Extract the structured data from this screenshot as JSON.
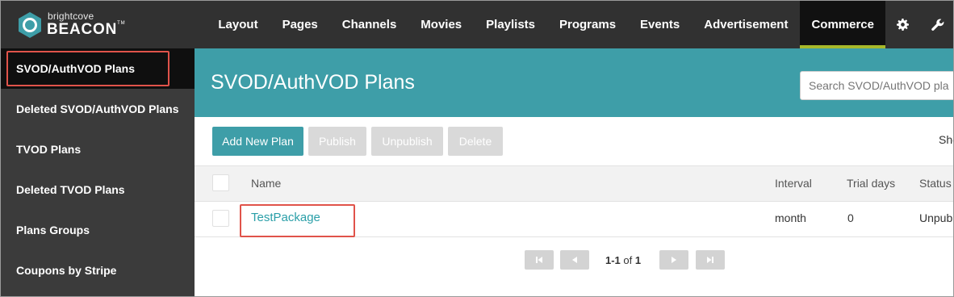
{
  "brand": {
    "small": "brightcove",
    "big": "BEACON",
    "tm": "TM"
  },
  "nav": {
    "items": [
      "Layout",
      "Pages",
      "Channels",
      "Movies",
      "Playlists",
      "Programs",
      "Events",
      "Advertisement",
      "Commerce"
    ],
    "active": "Commerce",
    "icons": [
      "gear-icon",
      "wrench-icon"
    ]
  },
  "sidebar": {
    "items": [
      {
        "label": "SVOD/AuthVOD Plans"
      },
      {
        "label": "Deleted SVOD/AuthVOD Plans"
      },
      {
        "label": "TVOD Plans"
      },
      {
        "label": "Deleted TVOD Plans"
      },
      {
        "label": "Plans Groups"
      },
      {
        "label": "Coupons by Stripe"
      }
    ]
  },
  "main": {
    "title": "SVOD/AuthVOD Plans",
    "search_placeholder": "Search SVOD/AuthVOD pla",
    "buttons": {
      "add": "Add New Plan",
      "publish": "Publish",
      "unpublish": "Unpublish",
      "delete": "Delete"
    },
    "show_label": "Sho",
    "table": {
      "columns": [
        "Name",
        "Interval",
        "Trial days",
        "Status"
      ],
      "rows": [
        {
          "name": "TestPackage",
          "interval": "month",
          "trial_days": "0",
          "status": "Unpub"
        }
      ]
    },
    "pagination": {
      "range": "1-1",
      "of": "of",
      "total": "1"
    }
  },
  "colors": {
    "topbar": "#313131",
    "sidebar": "#3b3b3b",
    "accent": "#3e9ea8",
    "active_underline": "#a7b82a",
    "highlight": "#e0534a"
  }
}
